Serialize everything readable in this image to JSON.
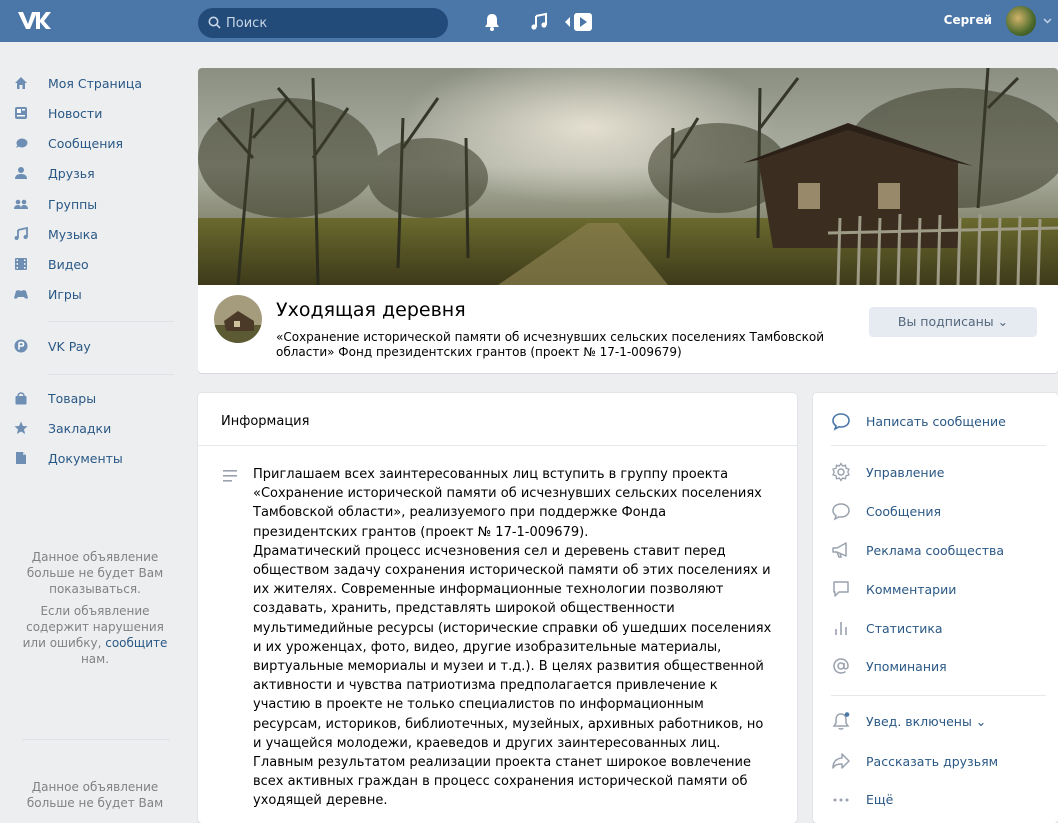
{
  "header": {
    "search_placeholder": "Поиск",
    "user_name": "Сергей"
  },
  "sidebar": {
    "items": [
      {
        "label": "Моя Страница",
        "icon": "home-icon"
      },
      {
        "label": "Новости",
        "icon": "news-icon"
      },
      {
        "label": "Сообщения",
        "icon": "messages-icon"
      },
      {
        "label": "Друзья",
        "icon": "friends-icon"
      },
      {
        "label": "Группы",
        "icon": "groups-icon"
      },
      {
        "label": "Музыка",
        "icon": "music-icon"
      },
      {
        "label": "Видео",
        "icon": "video-icon"
      },
      {
        "label": "Игры",
        "icon": "games-icon"
      },
      {
        "label": "VK Pay",
        "icon": "vkpay-icon"
      },
      {
        "label": "Товары",
        "icon": "goods-icon"
      },
      {
        "label": "Закладки",
        "icon": "bookmarks-icon"
      },
      {
        "label": "Документы",
        "icon": "documents-icon"
      }
    ],
    "ad": {
      "line1": "Данное объявление больше не будет Вам показываться.",
      "line2_pre": "Если объявление содержит нарушения или ошибку, ",
      "line2_link": "сообщите",
      "line2_post": " нам."
    },
    "ad2": "Данное объявление больше не будет Вам"
  },
  "group": {
    "title": "Уходящая деревня",
    "subtitle": "«Сохранение исторической памяти об исчезнувших сельских поселениях Тамбовской области» Фонд президентских грантов (проект № 17-1-009679)",
    "subscribe_label": "Вы подписаны ⌄"
  },
  "info": {
    "heading": "Информация",
    "text": "Приглашаем всех заинтересованных лиц вступить в группу проекта «Сохранение исторической памяти об исчезнувших сельских поселениях Тамбовской области», реализуемого при поддержке Фонда президентских грантов (проект № 17-1-009679).\nДраматический процесс исчезновения сел и деревень ставит перед обществом задачу сохранения исторической памяти об этих поселениях и их жителях. Современные информационные технологии позволяют создавать, хранить, представлять широкой общественности мультимедийные ресурсы (исторические справки об ушедших поселениях и их уроженцах, фото, видео, другие изобразительные материалы, виртуальные мемориалы и музеи и т.д.). В целях развития общественной активности и чувства патриотизма предполагается привлечение к участию в проекте не только специалистов по информационным ресурсам, историков, библиотечных, музейных, архивных работников, но и учащейся молодежи, краеведов и других заинтересованных лиц. Главным результатом реализации проекта станет широкое вовлечение всех активных граждан в процесс сохранения исторической памяти об уходящей деревне."
  },
  "actions": [
    {
      "label": "Написать сообщение",
      "icon": "chat-bubble-icon"
    },
    {
      "label": "Управление",
      "icon": "gear-icon"
    },
    {
      "label": "Сообщения",
      "icon": "message-icon"
    },
    {
      "label": "Реклама сообщества",
      "icon": "megaphone-icon"
    },
    {
      "label": "Комментарии",
      "icon": "comment-icon"
    },
    {
      "label": "Статистика",
      "icon": "stats-icon"
    },
    {
      "label": "Упоминания",
      "icon": "at-icon"
    },
    {
      "label": "Увед. включены ⌄",
      "icon": "bell-icon"
    },
    {
      "label": "Рассказать друзьям",
      "icon": "share-icon"
    },
    {
      "label": "Ещё",
      "icon": "more-icon"
    }
  ],
  "colors": {
    "header": "#4a76a8",
    "link": "#2a5885",
    "background": "#edeef0"
  }
}
